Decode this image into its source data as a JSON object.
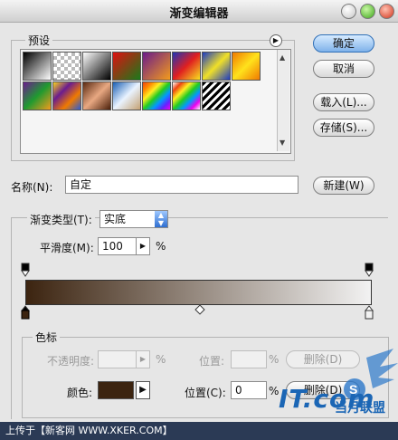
{
  "window": {
    "title": "渐变编辑器"
  },
  "presets": {
    "label": "预设",
    "swatches": [
      "black-white",
      "transparent-checker",
      "white-black",
      "red-green",
      "violet-orange",
      "blue-red-yellow",
      "blue-yellow-blue",
      "orange-yellow-orange",
      "violet-green-orange",
      "yellow-violet-orange-blue",
      "copper",
      "chrome",
      "spectrum",
      "transparent-rainbow",
      "transparent-stripes"
    ]
  },
  "buttons": {
    "ok": "确定",
    "cancel": "取消",
    "load": "载入(L)...",
    "save": "存储(S)...",
    "new": "新建(W)"
  },
  "name": {
    "label": "名称(N):",
    "value": "自定"
  },
  "gradient": {
    "type_label": "渐变类型(T):",
    "type_value": "实底",
    "smooth_label": "平滑度(M):",
    "smooth_value": "100",
    "smooth_unit": "%",
    "start_color": "#3c2410",
    "end_color": "#f2f2f2"
  },
  "stops": {
    "group_label": "色标",
    "opacity_label": "不透明度:",
    "opacity_unit": "%",
    "position_label_top": "位置:",
    "position_unit_top": "%",
    "delete_top": "删除(D)",
    "color_label": "颜色:",
    "position_label": "位置(C):",
    "position_value": "0",
    "position_unit": "%",
    "delete": "删除(D)"
  },
  "watermark": {
    "upload_text": "上传于【新客网 WWW.XKER.COM】",
    "logo_text": "IT.com",
    "logo_cn": "当月联盟"
  }
}
